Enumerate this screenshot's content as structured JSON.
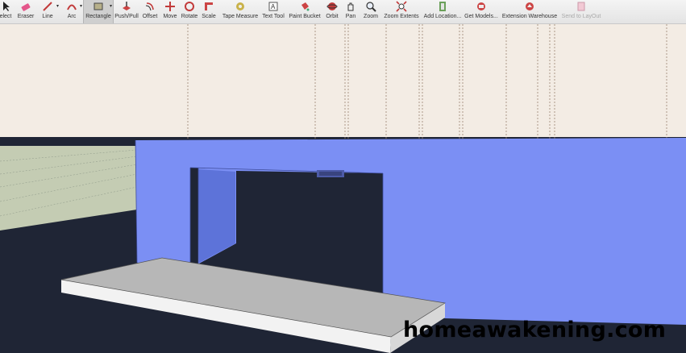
{
  "toolbar": {
    "tools": [
      {
        "id": "select",
        "label": "elect",
        "icon": "select-arrow-icon"
      },
      {
        "id": "eraser",
        "label": "Eraser",
        "icon": "eraser-icon"
      },
      {
        "id": "line",
        "label": "Line",
        "icon": "pencil-line-icon"
      },
      {
        "id": "arc",
        "label": "Arc",
        "icon": "arc-icon"
      },
      {
        "id": "rectangle",
        "label": "Rectangle",
        "icon": "rectangle-icon",
        "active": true
      },
      {
        "id": "pushpull",
        "label": "Push/Pull",
        "icon": "push-pull-icon"
      },
      {
        "id": "offset",
        "label": "Offset",
        "icon": "offset-icon"
      },
      {
        "id": "move",
        "label": "Move",
        "icon": "move-icon"
      },
      {
        "id": "rotate",
        "label": "Rotate",
        "icon": "rotate-icon"
      },
      {
        "id": "scale",
        "label": "Scale",
        "icon": "scale-icon"
      },
      {
        "id": "tape",
        "label": "Tape Measure",
        "icon": "tape-measure-icon"
      },
      {
        "id": "text",
        "label": "Text Tool",
        "icon": "text-tool-icon"
      },
      {
        "id": "paint",
        "label": "Paint Bucket",
        "icon": "paint-bucket-icon"
      },
      {
        "id": "orbit",
        "label": "Orbit",
        "icon": "orbit-icon"
      },
      {
        "id": "pan",
        "label": "Pan",
        "icon": "pan-hand-icon"
      },
      {
        "id": "zoom",
        "label": "Zoom",
        "icon": "zoom-icon"
      },
      {
        "id": "zoomext",
        "label": "Zoom Extents",
        "icon": "zoom-extents-icon"
      },
      {
        "id": "addloc",
        "label": "Add Location...",
        "icon": "add-location-icon"
      },
      {
        "id": "getmodels",
        "label": "Get Models...",
        "icon": "get-models-icon"
      },
      {
        "id": "extwh",
        "label": "Extension Warehouse",
        "icon": "extension-warehouse-icon"
      },
      {
        "id": "layout",
        "label": "Send to LayOut",
        "icon": "send-to-layout-icon",
        "disabled": true
      }
    ]
  },
  "colors": {
    "sky": "#f3ece4",
    "ground_green": "#c4ccb3",
    "ground_dark": "#1f2535",
    "wall_blue": "#7b8ff4",
    "wall_side": "#5d73d9",
    "slab_top": "#b7b7b7",
    "slab_edge": "#f2f2f2"
  },
  "watermark": "homeawakening.com"
}
